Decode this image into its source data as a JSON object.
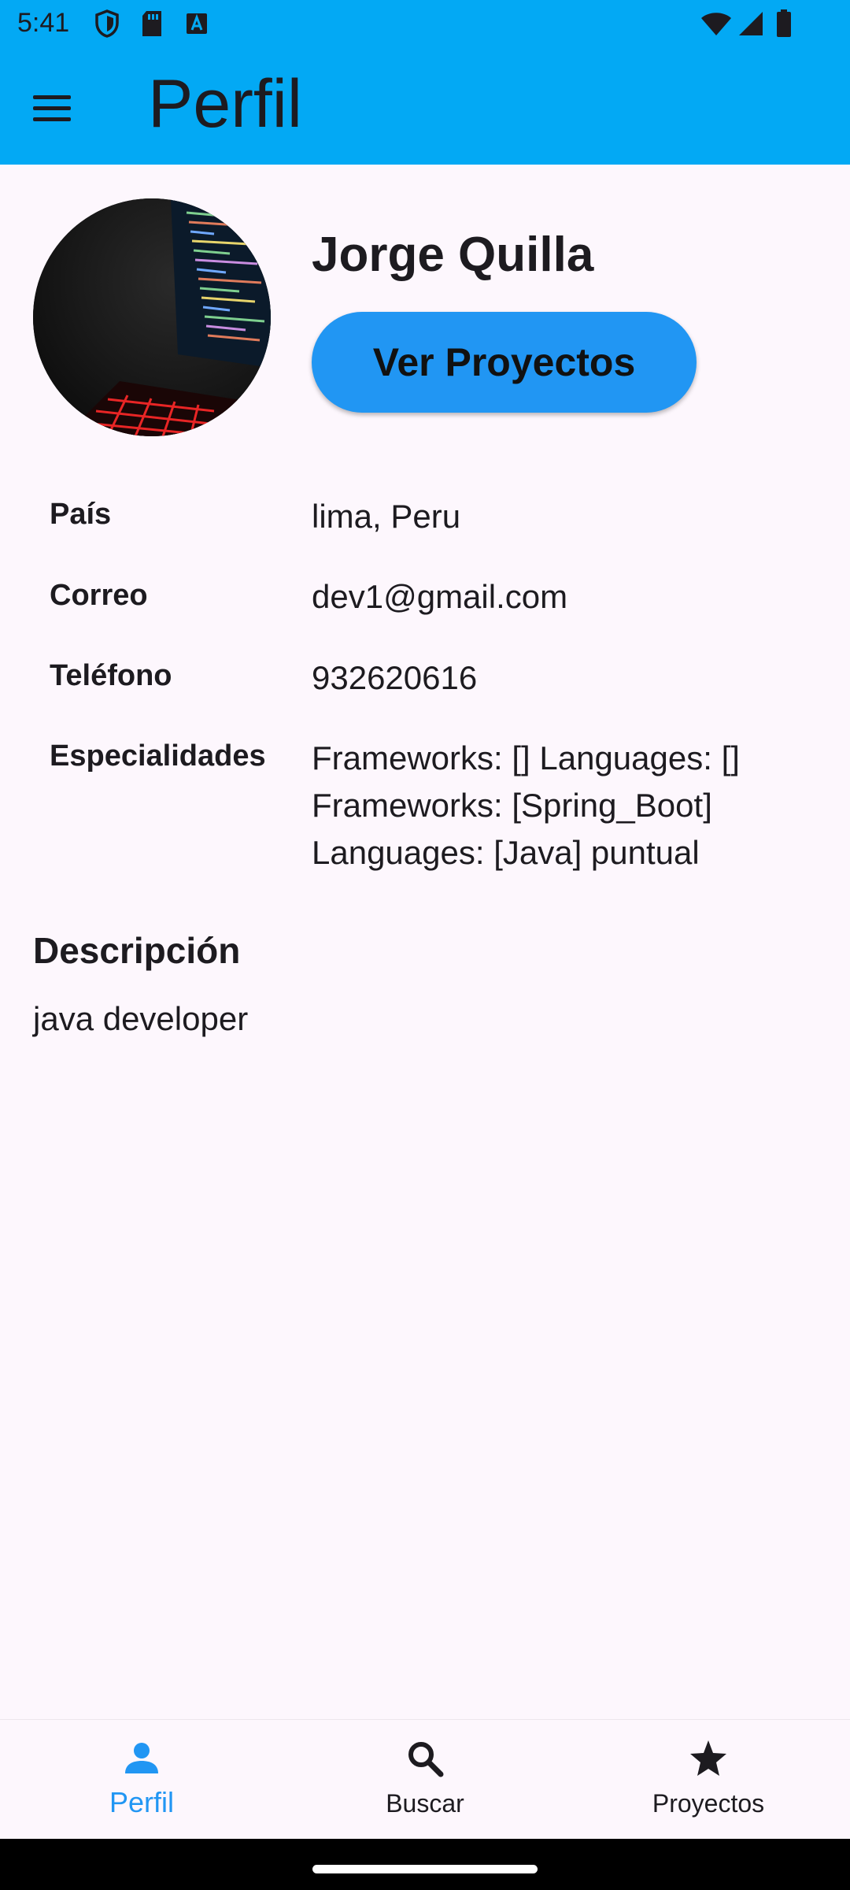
{
  "status_bar": {
    "time": "5:41"
  },
  "app_bar": {
    "title": "Perfil"
  },
  "profile": {
    "name": "Jorge Quilla",
    "projects_button": "Ver Proyectos",
    "fields": [
      {
        "label": "País",
        "value": "lima, Peru"
      },
      {
        "label": "Correo",
        "value": "dev1@gmail.com"
      },
      {
        "label": "Teléfono",
        "value": "932620616"
      },
      {
        "label": "Especialidades",
        "lines": [
          "Frameworks: [] Languages: []",
          "Frameworks: [Spring_Boot]",
          "Languages: [Java] puntual"
        ]
      }
    ],
    "description_title": "Descripción",
    "description": "java developer"
  },
  "bottom_nav": {
    "items": [
      {
        "label": "Perfil",
        "icon": "person-icon",
        "active": true
      },
      {
        "label": "Buscar",
        "icon": "search-icon",
        "active": false
      },
      {
        "label": "Proyectos",
        "icon": "star-icon",
        "active": false
      }
    ]
  },
  "colors": {
    "app_bar": "#03a9f4",
    "accent": "#2196f3",
    "background": "#fdf7fd"
  }
}
